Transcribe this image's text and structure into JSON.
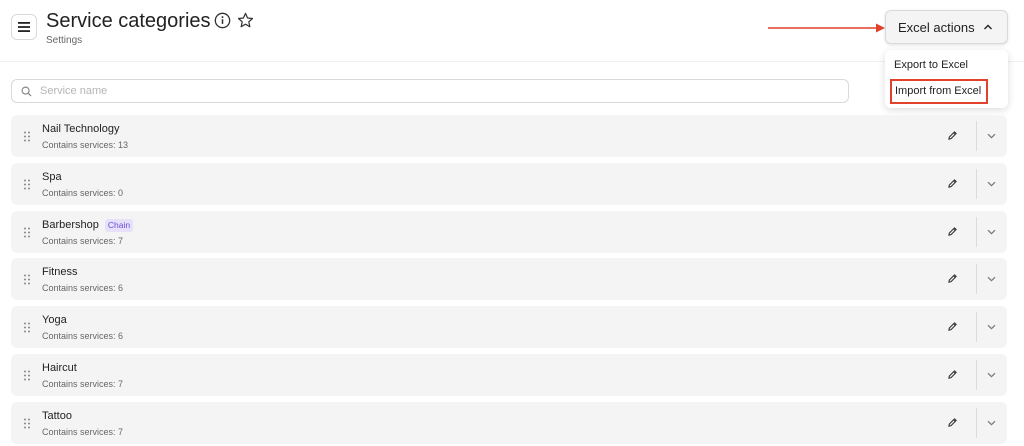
{
  "header": {
    "title": "Service categories",
    "subtitle": "Settings",
    "menu_icon": "hamburger-icon",
    "info_icon": "info-icon",
    "star_icon": "star-icon"
  },
  "excel": {
    "button_label": "Excel actions",
    "menu": [
      {
        "label": "Export to Excel"
      },
      {
        "label": "Import from Excel",
        "highlighted": true
      }
    ]
  },
  "search": {
    "placeholder": "Service name",
    "value": ""
  },
  "categories": [
    {
      "name": "Nail Technology",
      "badge": "",
      "count_text": "Contains services: 13"
    },
    {
      "name": "Spa",
      "badge": "",
      "count_text": "Contains services: 0"
    },
    {
      "name": "Barbershop",
      "badge": "Chain",
      "count_text": "Contains services: 7"
    },
    {
      "name": "Fitness",
      "badge": "",
      "count_text": "Contains services: 6"
    },
    {
      "name": "Yoga",
      "badge": "",
      "count_text": "Contains services: 6"
    },
    {
      "name": "Haircut",
      "badge": "",
      "count_text": "Contains services: 7"
    },
    {
      "name": "Tattoo",
      "badge": "",
      "count_text": "Contains services: 7"
    }
  ],
  "colors": {
    "accent_red": "#e2412c",
    "badge_text": "#6b4fd6",
    "badge_bg": "#e6e0fb",
    "row_bg": "#f4f4f4"
  }
}
